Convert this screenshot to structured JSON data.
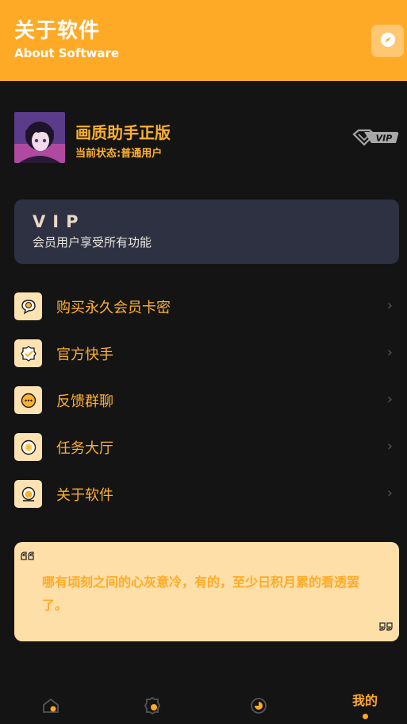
{
  "colors": {
    "accent": "#ffaa26",
    "background": "#141414",
    "card_dark": "#2d3142",
    "icon_bg": "#ffe2b1",
    "quote_bg": "#ffdfa8"
  },
  "header": {
    "title": "关于软件",
    "subtitle": "About Software",
    "action_icon": "compass-icon"
  },
  "profile": {
    "app_name": "画质助手正版",
    "status_text": "当前状态:普通用户",
    "badge": "VIP"
  },
  "vip_card": {
    "title": "VIP",
    "description": "会员用户享受所有功能"
  },
  "menu": {
    "items": [
      {
        "label": "购买永久会员卡密",
        "icon": "chat-bubble-icon"
      },
      {
        "label": "官方快手",
        "icon": "badge-check-icon"
      },
      {
        "label": "反馈群聊",
        "icon": "message-dots-icon"
      },
      {
        "label": "任务大厅",
        "icon": "coin-icon"
      },
      {
        "label": "关于软件",
        "icon": "info-icon"
      }
    ]
  },
  "quote": {
    "text": "哪有顷刻之间的心灰意冷，有的，至少日积月累的看透罢了。"
  },
  "tabbar": {
    "tabs": [
      {
        "icon": "home-icon"
      },
      {
        "icon": "badge-icon"
      },
      {
        "icon": "discover-icon"
      },
      {
        "label": "我的",
        "active": true
      }
    ]
  }
}
